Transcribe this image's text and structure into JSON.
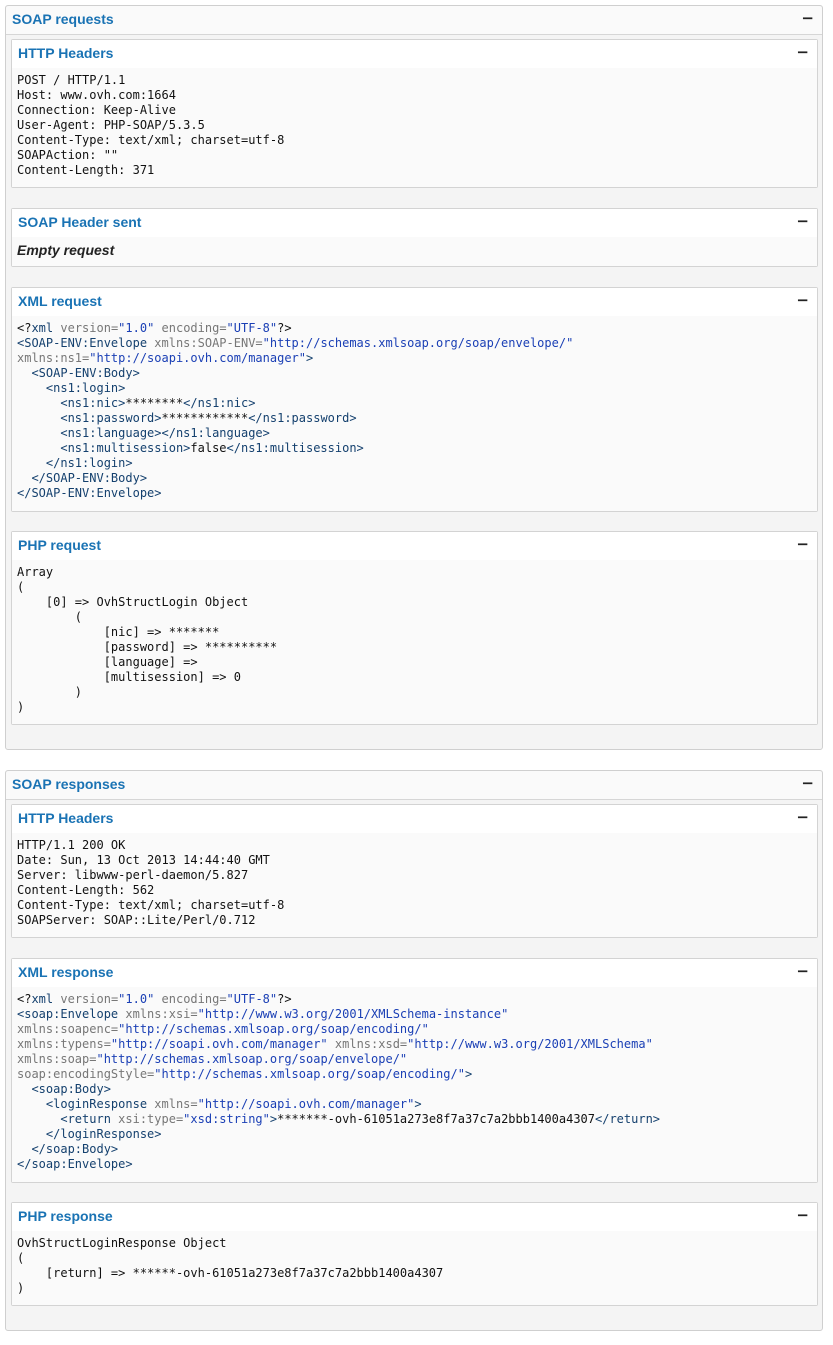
{
  "requests": {
    "title": "SOAP requests",
    "http_headers": {
      "title": "HTTP Headers",
      "lines": [
        "POST / HTTP/1.1",
        "Host: www.ovh.com:1664",
        "Connection: Keep-Alive",
        "User-Agent: PHP-SOAP/5.3.5",
        "Content-Type: text/xml; charset=utf-8",
        "SOAPAction: \"\"",
        "Content-Length: 371"
      ]
    },
    "soap_header": {
      "title": "SOAP Header sent",
      "text": "Empty request"
    },
    "xml_request": {
      "title": "XML request",
      "decl": {
        "open": "<?",
        "name": "xml",
        "attr1": " version=",
        "val1": "\"1.0\"",
        "attr2": " encoding=",
        "val2": "\"UTF-8\"",
        "close": "?>"
      },
      "envelope_open": "<SOAP-ENV:Envelope",
      "ns_env_attr": " xmlns:SOAP-ENV=",
      "ns_env_val": "\"http://schemas.xmlsoap.org/soap/envelope/\"",
      "ns1_attr": "xmlns:ns1=",
      "ns1_val": "\"http://soapi.ovh.com/manager\"",
      "ns1_close": ">",
      "body_open": "  <SOAP-ENV:Body>",
      "login_open": "    <ns1:login>",
      "nic": {
        "open": "      <ns1:nic>",
        "value": "********",
        "close": "</ns1:nic>"
      },
      "password": {
        "open": "      <ns1:password>",
        "value": "************",
        "close": "</ns1:password>"
      },
      "language": {
        "open": "      <ns1:language>",
        "close": "</ns1:language>"
      },
      "multisession": {
        "open": "      <ns1:multisession>",
        "value": "false",
        "close": "</ns1:multisession>"
      },
      "login_close": "    </ns1:login>",
      "body_close": "  </SOAP-ENV:Body>",
      "envelope_close": "</SOAP-ENV:Envelope>"
    },
    "php_request": {
      "title": "PHP request",
      "lines": [
        "Array",
        "(",
        "    [0] => OvhStructLogin Object",
        "        (",
        "            [nic] => *******",
        "            [password] => **********",
        "            [language] =>",
        "            [multisession] => 0",
        "        )",
        ")"
      ]
    }
  },
  "responses": {
    "title": "SOAP responses",
    "http_headers": {
      "title": "HTTP Headers",
      "lines": [
        "HTTP/1.1 200 OK",
        "Date: Sun, 13 Oct 2013 14:44:40 GMT",
        "Server: libwww-perl-daemon/5.827",
        "Content-Length: 562",
        "Content-Type: text/xml; charset=utf-8",
        "SOAPServer: SOAP::Lite/Perl/0.712"
      ]
    },
    "xml_response": {
      "title": "XML response",
      "decl": {
        "open": "<?",
        "name": "xml",
        "attr1": " version=",
        "val1": "\"1.0\"",
        "attr2": " encoding=",
        "val2": "\"UTF-8\"",
        "close": "?>"
      },
      "envelope_open": "<soap:Envelope",
      "xsi_attr": " xmlns:xsi=",
      "xsi_val": "\"http://www.w3.org/2001/XMLSchema-instance\"",
      "soapenc_attr": "xmlns:soapenc=",
      "soapenc_val": "\"http://schemas.xmlsoap.org/soap/encoding/\"",
      "typens_attr": "xmlns:typens=",
      "typens_val": "\"http://soapi.ovh.com/manager\"",
      "xsd_attr": " xmlns:xsd=",
      "xsd_val": "\"http://www.w3.org/2001/XMLSchema\"",
      "soap_attr": "xmlns:soap=",
      "soap_val": "\"http://schemas.xmlsoap.org/soap/envelope/\"",
      "encstyle_attr": "soap:encodingStyle=",
      "encstyle_val": "\"http://schemas.xmlsoap.org/soap/encoding/\"",
      "encstyle_close": ">",
      "body_open": "  <soap:Body>",
      "login_resp_open": "    <loginResponse",
      "login_resp_attr": " xmlns=",
      "login_resp_val": "\"http://soapi.ovh.com/manager\"",
      "login_resp_gt": ">",
      "return_open": "      <return",
      "return_attr": " xsi:type=",
      "return_type": "\"xsd:string\"",
      "return_gt": ">",
      "return_value": "*******-ovh-61051a273e8f7a37c7a2bbb1400a4307",
      "return_close": "</return>",
      "login_resp_close": "    </loginResponse>",
      "body_close": "  </soap:Body>",
      "envelope_close": "</soap:Envelope>"
    },
    "php_response": {
      "title": "PHP response",
      "lines": [
        "OvhStructLoginResponse Object",
        "(",
        "    [return] => ******-ovh-61051a273e8f7a37c7a2bbb1400a4307",
        ")"
      ]
    }
  },
  "collapse_symbol": "−",
  "colors": {
    "title": "#1a73b4",
    "tag": "#14406e",
    "attr": "#777777",
    "value": "#1a3fb5"
  }
}
